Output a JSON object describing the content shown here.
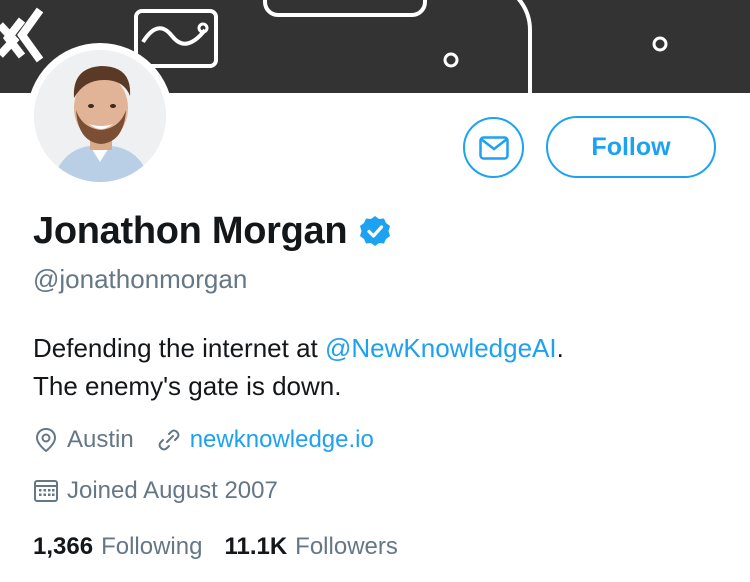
{
  "profile": {
    "name": "Jonathon Morgan",
    "handle": "@jonathonmorgan",
    "verified": true,
    "bio_prefix": "Defending the internet at ",
    "bio_mention": "@NewKnowledgeAI",
    "bio_after_mention": ".",
    "bio_line2": "The enemy's gate is down.",
    "location": "Austin",
    "website": "newknowledge.io",
    "joined": "Joined August 2007"
  },
  "actions": {
    "message_icon": "envelope-icon",
    "follow_label": "Follow"
  },
  "stats": {
    "following_count": "1,366",
    "following_label": "Following",
    "followers_count": "11.1K",
    "followers_label": "Followers"
  },
  "colors": {
    "accent": "#1da1f2",
    "banner": "#333333",
    "text": "#14171a",
    "secondary_text": "#657786"
  }
}
